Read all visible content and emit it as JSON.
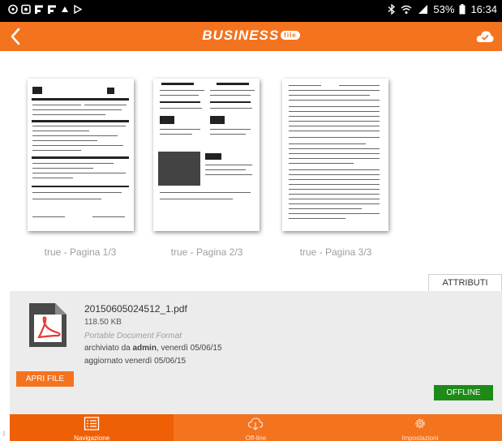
{
  "status_bar": {
    "battery": "53%",
    "time": "16:34"
  },
  "app_bar": {
    "brand": "BUSINESS",
    "brand_badge": "file"
  },
  "pages": [
    {
      "label": "true - Pagina 1/3"
    },
    {
      "label": "true - Pagina 2/3"
    },
    {
      "label": "true - Pagina 3/3"
    }
  ],
  "attributes_tab": "ATTRIBUTI",
  "file": {
    "name": "20150605024512_1.pdf",
    "size": "118.50 KB",
    "type": "Portable Document Format",
    "archived_prefix": "archiviato da ",
    "archived_user": "admin",
    "archived_suffix": ", venerdì 05/06/15",
    "updated": "aggiornato venerdì 05/06/15"
  },
  "buttons": {
    "open": "APRI FILE",
    "offline": "OFFLINE"
  },
  "nav": [
    {
      "label": "Navigazione",
      "icon": "list-icon",
      "active": true
    },
    {
      "label": "Off-line",
      "icon": "cloud-download-icon",
      "active": false
    },
    {
      "label": "Impostazioni",
      "icon": "gear-icon",
      "active": false
    }
  ],
  "corner_mark": "1",
  "colors": {
    "accent": "#f4731f",
    "accent_dark": "#ef5f06",
    "offline_green": "#1e8a18",
    "panel": "#ececec"
  }
}
